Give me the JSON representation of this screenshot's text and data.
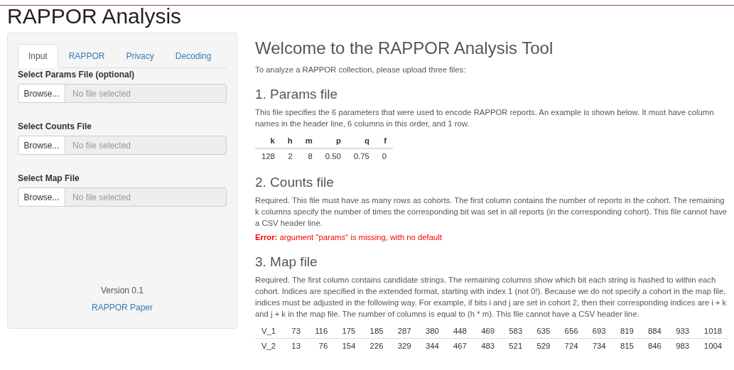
{
  "title": "RAPPOR Analysis",
  "sidebar": {
    "tabs": [
      {
        "label": "Input",
        "selected": true
      },
      {
        "label": "RAPPOR",
        "selected": false
      },
      {
        "label": "Privacy",
        "selected": false
      },
      {
        "label": "Decoding",
        "selected": false
      }
    ],
    "file_inputs": [
      {
        "label": "Select Params File (optional)",
        "button": "Browse...",
        "placeholder": "No file selected"
      },
      {
        "label": "Select Counts File",
        "button": "Browse...",
        "placeholder": "No file selected"
      },
      {
        "label": "Select Map File",
        "button": "Browse...",
        "placeholder": "No file selected"
      }
    ],
    "version": "Version 0.1",
    "link": "RAPPOR Paper"
  },
  "main": {
    "heading": "Welcome to the RAPPOR Analysis Tool",
    "intro": "To analyze a RAPPOR collection, please upload three files:",
    "sections": [
      {
        "heading": "1. Params file",
        "text": "This file specifies the 6 parameters that were used to encode RAPPOR reports. An example is shown below. It must have column names in the header line, 6 columns in this order, and 1 row.",
        "table": {
          "columns": [
            "k",
            "h",
            "m",
            "p",
            "q",
            "f"
          ],
          "rows": [
            [
              "128",
              "2",
              "8",
              "0.50",
              "0.75",
              "0"
            ]
          ]
        }
      },
      {
        "heading": "2. Counts file",
        "text": "Required. This file must have as many rows as cohorts. The first column contains the number of reports in the cohort. The remaining k columns specify the number of times the corresponding bit was set in all reports (in the corresponding cohort). This file cannot have a CSV header line.",
        "error": {
          "label": "Error:",
          "message": "argument \"params\" is missing, with no default"
        }
      },
      {
        "heading": "3. Map file",
        "text": "Required. The first column contains candidate strings. The remaining columns show which bit each string is hashed to within each cohort. Indices are specified in the extended format, starting with index 1 (not 0!). Because we do not specify a cohort in the map file, indices must be adjusted in the following way. For example, if bits i and j are set in cohort 2, then their corresponding indices are i + k and j + k in the map file. The number of columns is equal to (h * m). This file cannot have a CSV header line.",
        "table": {
          "rows": [
            [
              "V_1",
              "73",
              "116",
              "175",
              "185",
              "287",
              "380",
              "448",
              "469",
              "583",
              "635",
              "656",
              "693",
              "819",
              "884",
              "933",
              "1018"
            ],
            [
              "V_2",
              "13",
              "76",
              "154",
              "226",
              "329",
              "344",
              "467",
              "483",
              "521",
              "529",
              "724",
              "734",
              "815",
              "846",
              "983",
              "1004"
            ]
          ]
        }
      }
    ]
  }
}
